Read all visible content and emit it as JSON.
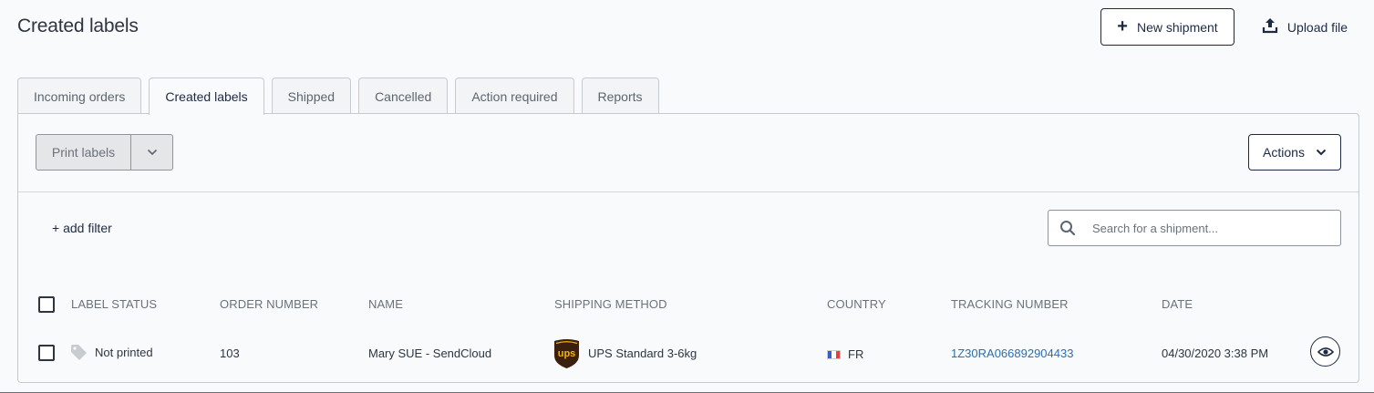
{
  "page": {
    "title": "Created labels"
  },
  "header_actions": {
    "new_shipment": "New shipment",
    "upload_file": "Upload file"
  },
  "tabs": [
    {
      "label": "Incoming orders",
      "active": false
    },
    {
      "label": "Created labels",
      "active": true
    },
    {
      "label": "Shipped",
      "active": false
    },
    {
      "label": "Cancelled",
      "active": false
    },
    {
      "label": "Action required",
      "active": false
    },
    {
      "label": "Reports",
      "active": false
    }
  ],
  "toolbar": {
    "print_labels": "Print labels",
    "actions": "Actions"
  },
  "filters": {
    "add_filter": "+ add filter",
    "search_placeholder": "Search for a shipment..."
  },
  "table": {
    "columns": [
      "LABEL STATUS",
      "ORDER NUMBER",
      "NAME",
      "SHIPPING METHOD",
      "COUNTRY",
      "TRACKING NUMBER",
      "DATE"
    ],
    "rows": [
      {
        "label_status": "Not printed",
        "order_number": "103",
        "name": "Mary SUE - SendCloud",
        "carrier_logo": "ups",
        "shipping_method": "UPS Standard 3-6kg",
        "country": "FR",
        "tracking_number": "1Z30RA066892904433",
        "date": "04/30/2020 3:38 PM"
      }
    ]
  },
  "colors": {
    "primary": "#1d2a43",
    "link": "#2a6fb0",
    "ups_brown": "#3b1f0f",
    "ups_gold": "#f5b400"
  },
  "icons": {
    "new_shipment": "plus-icon",
    "upload_file": "upload-icon",
    "print_dropdown": "chevron-down-icon",
    "actions": "chevron-down-icon",
    "search": "search-icon",
    "label_status": "tag-icon",
    "view": "eye-icon",
    "country": "france-flag-icon"
  }
}
